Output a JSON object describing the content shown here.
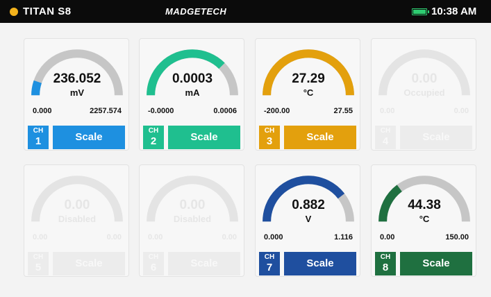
{
  "header": {
    "device": "TITAN S8",
    "brand": "MADGETECH",
    "time": "10:38 AM"
  },
  "colors": {
    "ch1": "#1e90e0",
    "ch2": "#1fbf8f",
    "ch3": "#e3a00d",
    "ch7": "#1f4f9f",
    "ch8": "#1f7040",
    "track": "#c6c6c6",
    "disabled": "#e4e4e4"
  },
  "channels": [
    {
      "ch_label": "CH",
      "number": "1",
      "value": "236.052",
      "unit": "mV",
      "min": "0.000",
      "max": "2257.574",
      "scale_label": "Scale",
      "level": 0.105,
      "color": "#1e90e0",
      "state": "active"
    },
    {
      "ch_label": "CH",
      "number": "2",
      "value": "0.0003",
      "unit": "mA",
      "min": "-0.0000",
      "max": "0.0006",
      "scale_label": "Scale",
      "level": 0.75,
      "color": "#1fbf8f",
      "state": "active"
    },
    {
      "ch_label": "CH",
      "number": "3",
      "value": "27.29",
      "unit": "°C",
      "min": "-200.00",
      "max": "27.55",
      "scale_label": "Scale",
      "level": 0.999,
      "color": "#e3a00d",
      "state": "active"
    },
    {
      "ch_label": "CH",
      "number": "4",
      "value": "0.00",
      "unit": "Occupied",
      "min": "0.00",
      "max": "0.00",
      "scale_label": "Scale",
      "level": 0,
      "color": "#e4e4e4",
      "state": "occupied"
    },
    {
      "ch_label": "CH",
      "number": "5",
      "value": "0.00",
      "unit": "Disabled",
      "min": "0.00",
      "max": "0.00",
      "scale_label": "Scale",
      "level": 0,
      "color": "#e4e4e4",
      "state": "disabled"
    },
    {
      "ch_label": "CH",
      "number": "6",
      "value": "0.00",
      "unit": "Disabled",
      "min": "0.00",
      "max": "0.00",
      "scale_label": "Scale",
      "level": 0,
      "color": "#e4e4e4",
      "state": "disabled"
    },
    {
      "ch_label": "CH",
      "number": "7",
      "value": "0.882",
      "unit": "V",
      "min": "0.000",
      "max": "1.116",
      "scale_label": "Scale",
      "level": 0.79,
      "color": "#1f4f9f",
      "state": "active"
    },
    {
      "ch_label": "CH",
      "number": "8",
      "value": "44.38",
      "unit": "°C",
      "min": "0.00",
      "max": "150.00",
      "scale_label": "Scale",
      "level": 0.296,
      "color": "#1f7040",
      "state": "active"
    }
  ]
}
